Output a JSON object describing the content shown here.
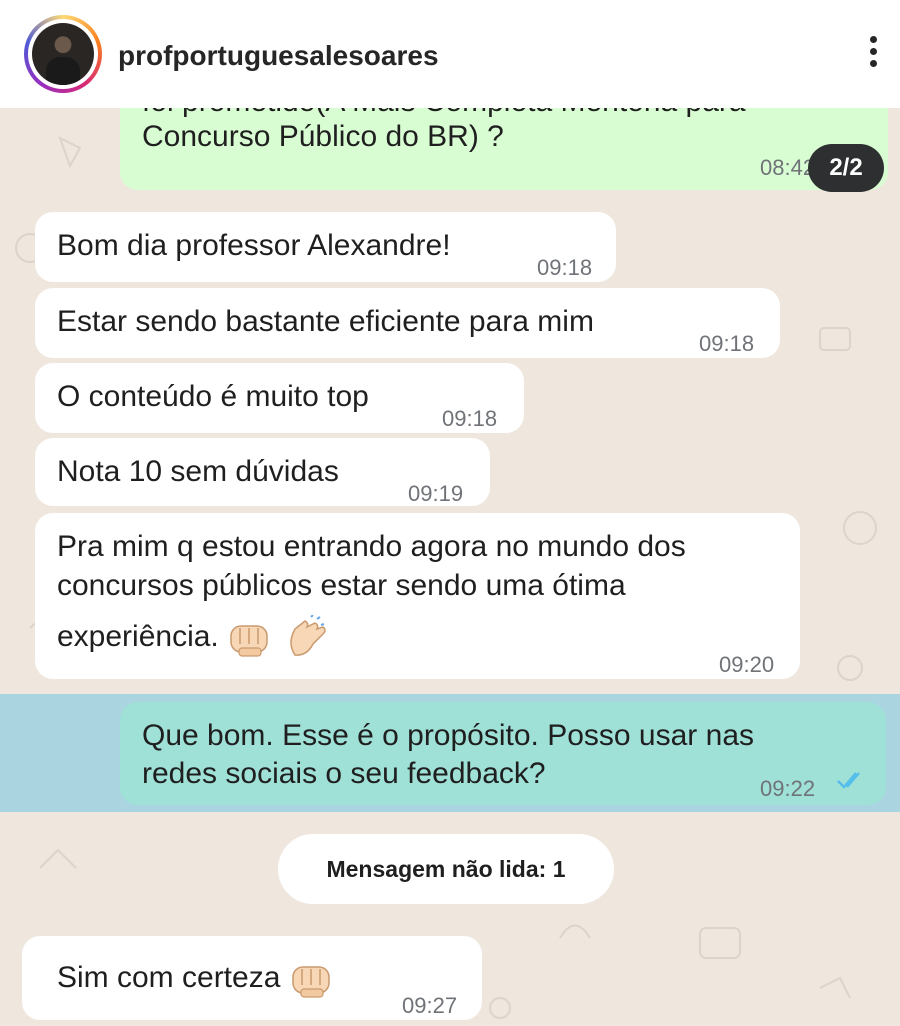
{
  "header": {
    "username": "profportuguesalesoares"
  },
  "page_indicator": "2/2",
  "messages": [
    {
      "direction": "out",
      "lines": [
        "foi prometido(A Mais Completa Mentoria para",
        "Concurso Público do BR) ?"
      ],
      "time": "08:42"
    },
    {
      "direction": "in",
      "text": "Bom dia professor Alexandre!",
      "time": "09:18"
    },
    {
      "direction": "in",
      "text": "Estar sendo bastante eficiente para mim",
      "time": "09:18"
    },
    {
      "direction": "in",
      "text": "O conteúdo é muito top",
      "time": "09:18"
    },
    {
      "direction": "in",
      "text": "Nota 10 sem dúvidas",
      "time": "09:19"
    },
    {
      "direction": "in",
      "lines": [
        "Pra mim q estou entrando agora no mundo dos",
        "concursos públicos estar sendo uma ótima",
        "experiência."
      ],
      "time": "09:20"
    },
    {
      "direction": "out",
      "lines": [
        "Que bom. Esse é o propósito. Posso usar nas",
        "redes sociais o seu feedback?"
      ],
      "time": "09:22",
      "status": "read"
    },
    {
      "direction": "in",
      "text": "Sim com certeza",
      "time": "09:27"
    }
  ],
  "unread_banner": "Mensagem não lida: 1",
  "colors": {
    "incoming_bubble": "#ffffff",
    "outgoing_bubble": "#d9fdd3",
    "highlight_band": "#a9d4e0",
    "read_ticks": "#53bdeb"
  }
}
